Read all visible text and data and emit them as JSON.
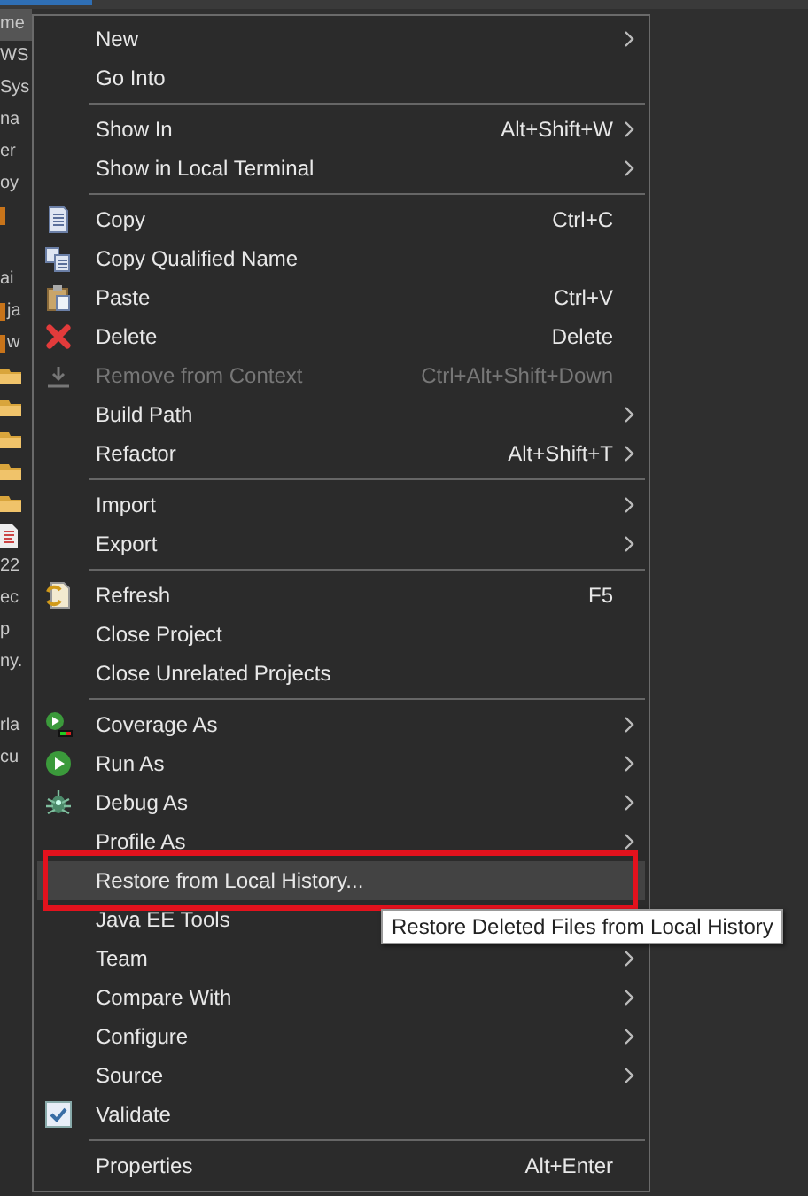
{
  "explorer": {
    "rows": [
      {
        "kind": "text",
        "text": "me",
        "selected": true,
        "decorated": false
      },
      {
        "kind": "text",
        "text": "WS",
        "selected": false,
        "decorated": false
      },
      {
        "kind": "text",
        "text": "Sys",
        "selected": false,
        "decorated": false
      },
      {
        "kind": "text",
        "text": "na",
        "selected": false,
        "decorated": false
      },
      {
        "kind": "text",
        "text": "er",
        "selected": false,
        "decorated": false
      },
      {
        "kind": "text",
        "text": "oy",
        "selected": false,
        "decorated": false
      },
      {
        "kind": "mark",
        "selected": false,
        "decorated": true
      },
      {
        "kind": "blank",
        "selected": false,
        "decorated": false
      },
      {
        "kind": "text",
        "text": "ai",
        "selected": false,
        "decorated": false
      },
      {
        "kind": "text",
        "text": "ja",
        "selected": false,
        "decorated": true
      },
      {
        "kind": "text",
        "text": "w",
        "selected": false,
        "decorated": true
      },
      {
        "kind": "folder",
        "selected": false,
        "decorated": false
      },
      {
        "kind": "folder",
        "selected": false,
        "decorated": false
      },
      {
        "kind": "folder",
        "selected": false,
        "decorated": false
      },
      {
        "kind": "folder",
        "selected": false,
        "decorated": false
      },
      {
        "kind": "folder",
        "selected": false,
        "decorated": false
      },
      {
        "kind": "file",
        "selected": false,
        "decorated": false
      },
      {
        "kind": "text",
        "text": "22",
        "selected": false,
        "decorated": false
      },
      {
        "kind": "text",
        "text": "ec",
        "selected": false,
        "decorated": false
      },
      {
        "kind": "text",
        "text": "p",
        "selected": false,
        "decorated": false
      },
      {
        "kind": "text",
        "text": "ny.",
        "selected": false,
        "decorated": false
      },
      {
        "kind": "blank",
        "selected": false,
        "decorated": false
      },
      {
        "kind": "text",
        "text": "rla",
        "selected": false,
        "decorated": false
      },
      {
        "kind": "text",
        "text": "cu",
        "selected": false,
        "decorated": false
      }
    ]
  },
  "context_menu": {
    "items": [
      {
        "kind": "item",
        "label": "New",
        "submenu": true,
        "disabled": false,
        "selected": false
      },
      {
        "kind": "item",
        "label": "Go Into",
        "submenu": false,
        "disabled": false,
        "selected": false
      },
      {
        "kind": "separator"
      },
      {
        "kind": "item",
        "label": "Show In",
        "shortcut": "Alt+Shift+W",
        "submenu": true,
        "disabled": false,
        "selected": false
      },
      {
        "kind": "item",
        "label": "Show in Local Terminal",
        "submenu": true,
        "disabled": false,
        "selected": false
      },
      {
        "kind": "separator"
      },
      {
        "kind": "item",
        "label": "Copy",
        "shortcut": "Ctrl+C",
        "submenu": false,
        "disabled": false,
        "selected": false
      },
      {
        "kind": "item",
        "label": "Copy Qualified Name",
        "submenu": false,
        "disabled": false,
        "selected": false
      },
      {
        "kind": "item",
        "label": "Paste",
        "shortcut": "Ctrl+V",
        "submenu": false,
        "disabled": false,
        "selected": false
      },
      {
        "kind": "item",
        "label": "Delete",
        "shortcut": "Delete",
        "submenu": false,
        "disabled": false,
        "selected": false
      },
      {
        "kind": "item",
        "label": "Remove from Context",
        "shortcut": "Ctrl+Alt+Shift+Down",
        "submenu": false,
        "disabled": true,
        "selected": false
      },
      {
        "kind": "item",
        "label": "Build Path",
        "submenu": true,
        "disabled": false,
        "selected": false
      },
      {
        "kind": "item",
        "label": "Refactor",
        "shortcut": "Alt+Shift+T",
        "submenu": true,
        "disabled": false,
        "selected": false
      },
      {
        "kind": "separator"
      },
      {
        "kind": "item",
        "label": "Import",
        "submenu": true,
        "disabled": false,
        "selected": false
      },
      {
        "kind": "item",
        "label": "Export",
        "submenu": true,
        "disabled": false,
        "selected": false
      },
      {
        "kind": "separator"
      },
      {
        "kind": "item",
        "label": "Refresh",
        "shortcut": "F5",
        "submenu": false,
        "disabled": false,
        "selected": false
      },
      {
        "kind": "item",
        "label": "Close Project",
        "submenu": false,
        "disabled": false,
        "selected": false
      },
      {
        "kind": "item",
        "label": "Close Unrelated Projects",
        "submenu": false,
        "disabled": false,
        "selected": false
      },
      {
        "kind": "separator"
      },
      {
        "kind": "item",
        "label": "Coverage As",
        "submenu": true,
        "disabled": false,
        "selected": false
      },
      {
        "kind": "item",
        "label": "Run As",
        "submenu": true,
        "disabled": false,
        "selected": false
      },
      {
        "kind": "item",
        "label": "Debug As",
        "submenu": true,
        "disabled": false,
        "selected": false
      },
      {
        "kind": "item",
        "label": "Profile As",
        "submenu": true,
        "disabled": false,
        "selected": false
      },
      {
        "kind": "item",
        "label": "Restore from Local History...",
        "submenu": false,
        "disabled": false,
        "selected": true
      },
      {
        "kind": "item",
        "label": "Java EE Tools",
        "submenu": false,
        "disabled": false,
        "selected": false
      },
      {
        "kind": "item",
        "label": "Team",
        "submenu": true,
        "disabled": false,
        "selected": false
      },
      {
        "kind": "item",
        "label": "Compare With",
        "submenu": true,
        "disabled": false,
        "selected": false
      },
      {
        "kind": "item",
        "label": "Configure",
        "submenu": true,
        "disabled": false,
        "selected": false
      },
      {
        "kind": "item",
        "label": "Source",
        "submenu": true,
        "disabled": false,
        "selected": false
      },
      {
        "kind": "check",
        "label": "Validate",
        "checked": true,
        "submenu": false,
        "disabled": false,
        "selected": false
      },
      {
        "kind": "separator"
      },
      {
        "kind": "item",
        "label": "Properties",
        "shortcut": "Alt+Enter",
        "submenu": false,
        "disabled": false,
        "selected": false
      }
    ]
  },
  "tooltip": {
    "text": "Restore Deleted Files from Local History"
  }
}
